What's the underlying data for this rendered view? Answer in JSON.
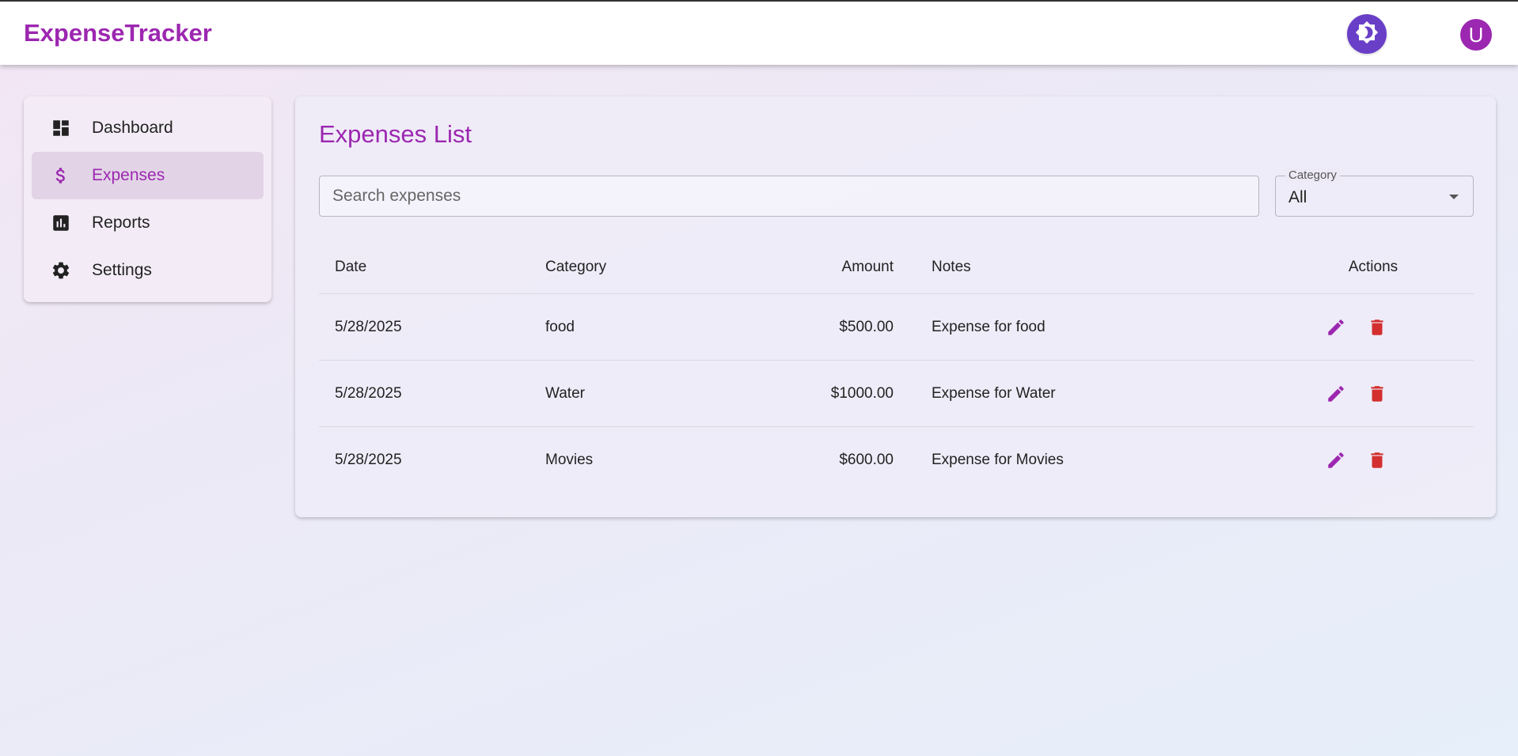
{
  "app": {
    "brand": "ExpenseTracker",
    "avatar_initial": "U"
  },
  "colors": {
    "accent": "#9c27b0",
    "theme_button": "#6a3fc8",
    "delete": "#d32f2f"
  },
  "sidebar": {
    "items": [
      {
        "label": "Dashboard",
        "icon": "dashboard-icon"
      },
      {
        "label": "Expenses",
        "icon": "dollar-icon",
        "active": true
      },
      {
        "label": "Reports",
        "icon": "bar-chart-icon"
      },
      {
        "label": "Settings",
        "icon": "gear-icon"
      }
    ]
  },
  "main": {
    "title": "Expenses List",
    "search": {
      "placeholder": "Search expenses",
      "value": ""
    },
    "category_filter": {
      "label": "Category",
      "value": "All"
    },
    "table": {
      "headers": {
        "date": "Date",
        "category": "Category",
        "amount": "Amount",
        "notes": "Notes",
        "actions": "Actions"
      },
      "rows": [
        {
          "date": "5/28/2025",
          "category": "food",
          "amount": "$500.00",
          "notes": "Expense for food"
        },
        {
          "date": "5/28/2025",
          "category": "Water",
          "amount": "$1000.00",
          "notes": "Expense for Water"
        },
        {
          "date": "5/28/2025",
          "category": "Movies",
          "amount": "$600.00",
          "notes": "Expense for Movies"
        }
      ]
    }
  }
}
